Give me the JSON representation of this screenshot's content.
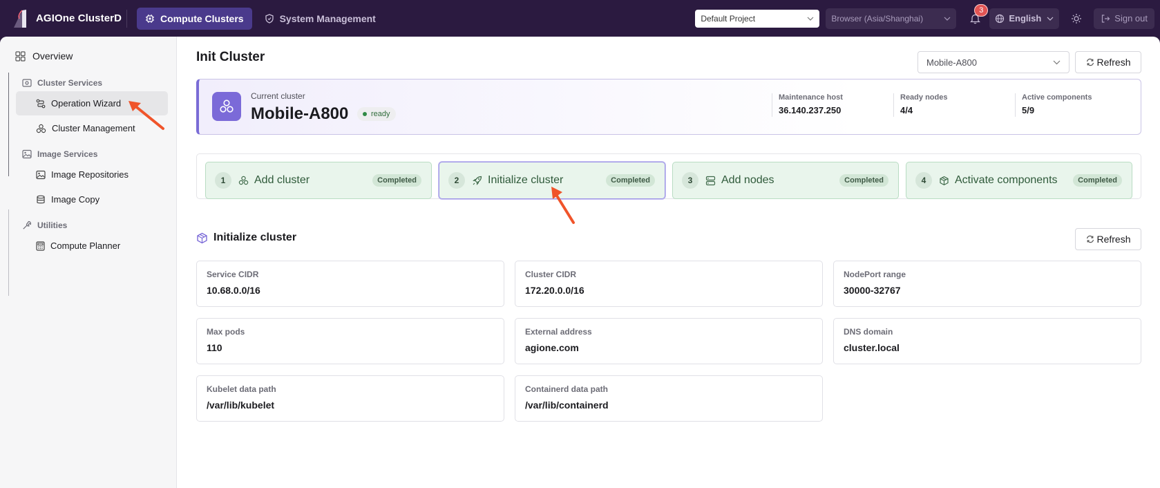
{
  "app": {
    "name": "AGIOne ClusterD",
    "nav_tabs": [
      {
        "label": "Compute Clusters",
        "active": true
      },
      {
        "label": "System Management",
        "active": false
      }
    ],
    "project_select": "Default Project",
    "timezone_select": "Browser (Asia/Shanghai)",
    "notifications_count": "3",
    "language": "English",
    "sign_out": "Sign out"
  },
  "sidebar": {
    "overview": "Overview",
    "groups": [
      {
        "label": "Cluster Services",
        "icon": "cluster-services-icon",
        "items": [
          {
            "label": "Operation Wizard",
            "icon": "wizard-icon",
            "active": true
          },
          {
            "label": "Cluster Management",
            "icon": "cluster-management-icon",
            "active": false
          }
        ]
      },
      {
        "label": "Image Services",
        "icon": "image-services-icon",
        "items": [
          {
            "label": "Image Repositories",
            "icon": "image-repo-icon",
            "active": false
          },
          {
            "label": "Image Copy",
            "icon": "image-copy-icon",
            "active": false
          }
        ]
      },
      {
        "label": "Utilities",
        "icon": "wrench-icon",
        "items": [
          {
            "label": "Compute Planner",
            "icon": "calculator-icon",
            "active": false
          }
        ]
      }
    ]
  },
  "page": {
    "title": "Init Cluster",
    "cluster_select": "Mobile-A800",
    "refresh_label": "Refresh"
  },
  "cluster": {
    "current_label": "Current cluster",
    "name": "Mobile-A800",
    "status": "ready",
    "metrics": [
      {
        "label": "Maintenance host",
        "value": "36.140.237.250"
      },
      {
        "label": "Ready nodes",
        "value": "4/4"
      },
      {
        "label": "Active components",
        "value": "5/9"
      }
    ]
  },
  "steps": [
    {
      "num": "1",
      "label": "Add cluster",
      "status": "Completed",
      "icon": "cluster-icon"
    },
    {
      "num": "2",
      "label": "Initialize cluster",
      "status": "Completed",
      "icon": "rocket-icon"
    },
    {
      "num": "3",
      "label": "Add nodes",
      "status": "Completed",
      "icon": "server-icon"
    },
    {
      "num": "4",
      "label": "Activate components",
      "status": "Completed",
      "icon": "package-icon"
    }
  ],
  "section": {
    "title": "Initialize cluster",
    "refresh_label": "Refresh",
    "fields": [
      {
        "label": "Service CIDR",
        "value": "10.68.0.0/16"
      },
      {
        "label": "Cluster CIDR",
        "value": "172.20.0.0/16"
      },
      {
        "label": "NodePort range",
        "value": "30000-32767"
      },
      {
        "label": "Max pods",
        "value": "110"
      },
      {
        "label": "External address",
        "value": "agione.com"
      },
      {
        "label": "DNS domain",
        "value": "cluster.local"
      },
      {
        "label": "Kubelet data path",
        "value": "/var/lib/kubelet"
      },
      {
        "label": "Containerd data path",
        "value": "/var/lib/containerd"
      }
    ]
  },
  "colors": {
    "topbar": "#2b1a40",
    "accent": "#7b6ad8",
    "step_done": "#e9f5ec",
    "annotation_arrow": "#f0542a"
  }
}
